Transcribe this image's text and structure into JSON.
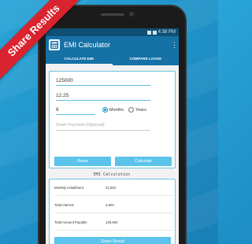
{
  "ribbon": {
    "label": "Share Results"
  },
  "status_bar": {
    "time": "4:38 PM"
  },
  "app_bar": {
    "title": "EMI Calculator",
    "overflow": "⋮"
  },
  "tabs": [
    {
      "label": "CALCULATE EMI",
      "active": true
    },
    {
      "label": "COMPARE LOANS",
      "active": false
    }
  ],
  "form": {
    "principal": "125000",
    "interest_rate": "12.25",
    "tenure": "6",
    "down_payment_placeholder": "Down Payment (Optional)",
    "tenure_units": [
      {
        "label": "Months",
        "selected": true
      },
      {
        "label": "Years",
        "selected": false
      }
    ],
    "reset_label": "Reset",
    "calculate_label": "Calculate"
  },
  "result": {
    "header": "EMI Calculation",
    "rows": [
      {
        "label": "Monthly Installment",
        "value": "21,584"
      },
      {
        "label": "Total Interest",
        "value": "4,504"
      },
      {
        "label": "Total Amount Payable",
        "value": "129,504"
      }
    ],
    "share_label": "Share Result"
  },
  "colors": {
    "accent": "#1571a6",
    "button": "#5cc3ea",
    "ribbon": "#d9232e",
    "background": "#2aa4d8"
  }
}
